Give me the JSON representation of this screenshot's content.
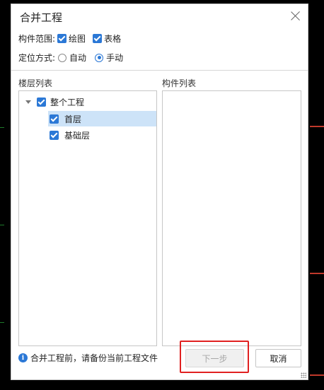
{
  "dialog": {
    "title": "合并工程"
  },
  "scope": {
    "label": "构件范围:",
    "options": [
      {
        "label": "绘图",
        "checked": true
      },
      {
        "label": "表格",
        "checked": true
      }
    ]
  },
  "positioning": {
    "label": "定位方式:",
    "options": [
      {
        "label": "自动",
        "selected": false
      },
      {
        "label": "手动",
        "selected": true
      }
    ]
  },
  "floor_list": {
    "title": "楼层列表",
    "root": {
      "label": "整个工程",
      "checked": true,
      "expanded": true
    },
    "items": [
      {
        "label": "首层",
        "checked": true,
        "selected": true
      },
      {
        "label": "基础层",
        "checked": true,
        "selected": false
      }
    ]
  },
  "component_list": {
    "title": "构件列表",
    "items": []
  },
  "footer": {
    "info_text": "合并工程前，请备份当前工程文件",
    "info_icon": "i"
  },
  "buttons": {
    "next": "下一步",
    "cancel": "取消"
  },
  "colors": {
    "accent": "#2b78d6",
    "highlight": "#e02020",
    "selection": "#cde3f8"
  }
}
